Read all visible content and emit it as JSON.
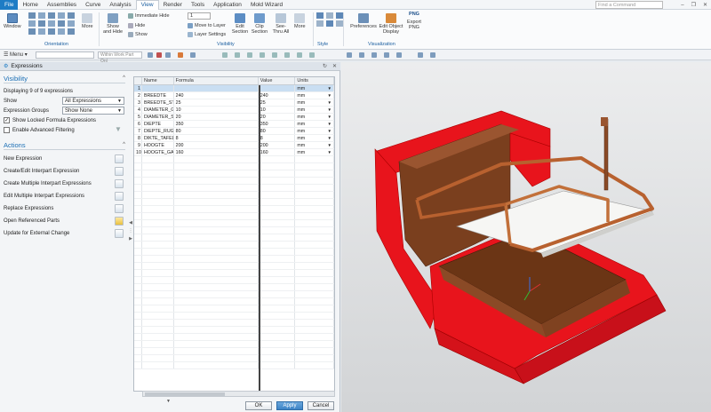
{
  "menubar": {
    "file": "File",
    "items": [
      "Home",
      "Assemblies",
      "Curve",
      "Analysis",
      "View",
      "Render",
      "Tools",
      "Application",
      "Mold Wizard"
    ],
    "active": "View",
    "search_placeholder": "Find a Command"
  },
  "ribbon": {
    "window": "Window",
    "more1": "More",
    "show_hide": "Show and Hide",
    "immediate_hide": "Immediate Hide",
    "hide": "Hide",
    "show": "Show",
    "layer_value": "1",
    "move_to_layer": "Move to Layer",
    "layer_settings": "Layer Settings",
    "edit_section": "Edit Section",
    "clip_section": "Clip Section",
    "see_thru_all": "See-Thru All",
    "more2": "More",
    "preferences": "Preferences",
    "edit_object_display": "Edit Object Display",
    "png_badge": "PNG",
    "export_png": "Export PNG",
    "groups": {
      "orientation": "Orientation",
      "visibility": "Visibility",
      "style": "Style",
      "visualization": "Visualization"
    }
  },
  "toolbar": {
    "menu": "Menu",
    "selection_scope": "Within Work Part Onl"
  },
  "expressions": {
    "title": "Expressions",
    "visibility": {
      "heading": "Visibility",
      "displaying": "Displaying 9 of 9 expressions",
      "show_label": "Show",
      "show_value": "All Expressions",
      "groups_label": "Expression Groups",
      "groups_value": "Show None",
      "show_locked": "Show Locked Formula Expressions",
      "advanced_filter": "Enable Advanced Filtering"
    },
    "actions": {
      "heading": "Actions",
      "items": [
        "New Expression",
        "Create/Edit Interpart Expression",
        "Create Multiple Interpart Expressions",
        "Edit Multiple Interpart Expressions",
        "Replace Expressions",
        "Open Referenced Parts",
        "Update for External Change"
      ]
    },
    "table": {
      "columns": [
        "",
        "Name",
        "Formula",
        "Value",
        "Units"
      ],
      "rows": [
        {
          "n": "1",
          "name": "",
          "formula": "",
          "value": "",
          "units": "mm"
        },
        {
          "n": "2",
          "name": "BREEDTE",
          "formula": "240",
          "value": "240",
          "units": "mm"
        },
        {
          "n": "3",
          "name": "BREEDTE_STRIPS",
          "formula": "25",
          "value": "25",
          "units": "mm"
        },
        {
          "n": "4",
          "name": "DIAMETER_GAT",
          "formula": "10",
          "value": "10",
          "units": "mm"
        },
        {
          "n": "5",
          "name": "DIAMETER_STAAF",
          "formula": "20",
          "value": "20",
          "units": "mm"
        },
        {
          "n": "6",
          "name": "DIEPTE",
          "formula": "350",
          "value": "350",
          "units": "mm"
        },
        {
          "n": "7",
          "name": "DIEPTE_RUG",
          "formula": "80",
          "value": "80",
          "units": "mm"
        },
        {
          "n": "8",
          "name": "DIKTE_TAFEL",
          "formula": "8",
          "value": "8",
          "units": "mm"
        },
        {
          "n": "9",
          "name": "HOOGTE",
          "formula": "200",
          "value": "200",
          "units": "mm"
        },
        {
          "n": "10",
          "name": "HOOGTE_GAT",
          "formula": "160",
          "value": "160",
          "units": "mm"
        }
      ]
    },
    "buttons": {
      "ok": "OK",
      "apply": "Apply",
      "cancel": "Cancel"
    }
  },
  "colors": {
    "accent": "#1e7cc5",
    "chair_red": "#e8141c",
    "wood": "#7a3f1e",
    "rod": "#b8612f"
  }
}
